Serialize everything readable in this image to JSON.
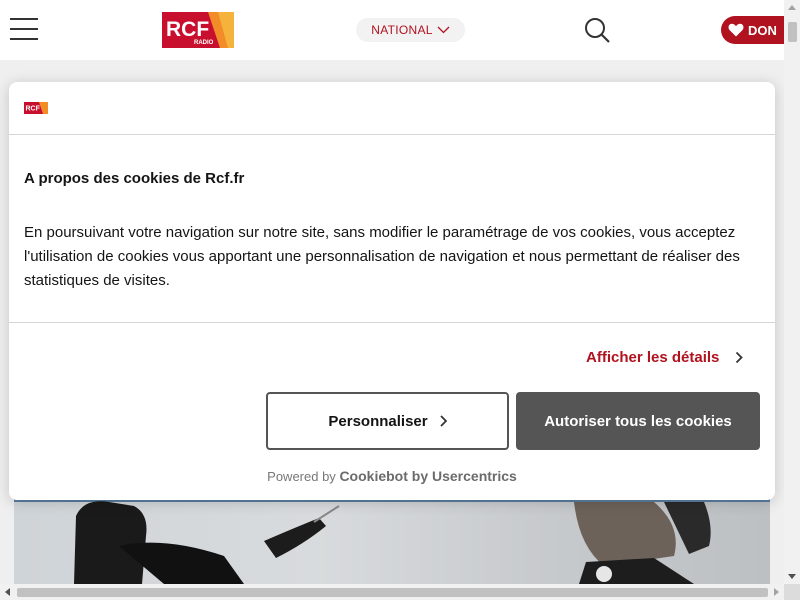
{
  "header": {
    "logo_text": "RCF",
    "logo_subtext": "RADIO",
    "region_label": "NATIONAL",
    "donate_label": "DON"
  },
  "cookie_dialog": {
    "title": "A propos des cookies de Rcf.fr",
    "body": "En poursuivant votre navigation sur notre site, sans modifier le paramétrage de vos cookies, vous acceptez l'utilisation de cookies vous apportant une personnalisation de navigation et nous permettant de réaliser des statistiques de visites.",
    "details_link": "Afficher les détails",
    "customize_button": "Personnaliser",
    "allow_all_button": "Autoriser tous les cookies",
    "powered_by_prefix": "Powered by",
    "powered_by_brand": "Cookiebot by Usercentrics"
  },
  "colors": {
    "brand_red": "#b0121f",
    "brand_orange": "#f5a623",
    "button_dark": "#555555"
  },
  "icons": [
    "menu-icon",
    "chevron-down-icon",
    "search-icon",
    "heart-icon",
    "chevron-right-icon"
  ]
}
